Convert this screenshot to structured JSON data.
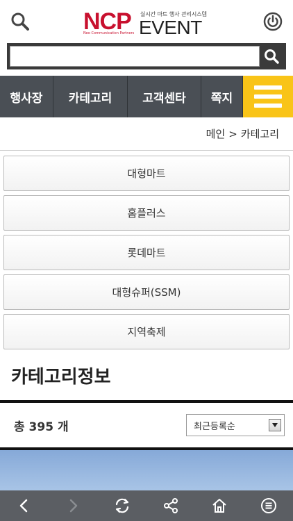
{
  "header": {
    "logo_ncp": "NCP",
    "logo_event": "EVENT",
    "logo_tagline": "실시간 마트 행사 관리시스템",
    "logo_sub": "Neo Communication Partners",
    "icons": {
      "search": "search-icon",
      "power": "power-icon"
    }
  },
  "search": {
    "value": "",
    "placeholder": "",
    "button_icon": "search-icon"
  },
  "nav": {
    "items": [
      {
        "label": "행사장"
      },
      {
        "label": "카테고리"
      },
      {
        "label": "고객센타"
      },
      {
        "label": "쪽지"
      }
    ],
    "menu_icon": "hamburger-icon",
    "menu_color": "#f9c418"
  },
  "breadcrumb": {
    "home": "메인",
    "separator": ">",
    "current": "카테고리"
  },
  "categories": [
    {
      "label": "대형마트"
    },
    {
      "label": "홈플러스"
    },
    {
      "label": "롯데마트"
    },
    {
      "label": "대형슈퍼(SSM)"
    },
    {
      "label": "지역축제"
    }
  ],
  "category_info": {
    "title": "카테고리정보",
    "count_text": "총 395 개",
    "sort_selected": "최근등록순"
  },
  "toolbar": {
    "icons": [
      "back-icon",
      "forward-icon",
      "refresh-icon",
      "share-icon",
      "home-icon",
      "menu-icon"
    ]
  },
  "colors": {
    "brand_red": "#c8102e",
    "nav_bg": "#4a4f55",
    "toolbar_bg": "#5b5e63"
  }
}
